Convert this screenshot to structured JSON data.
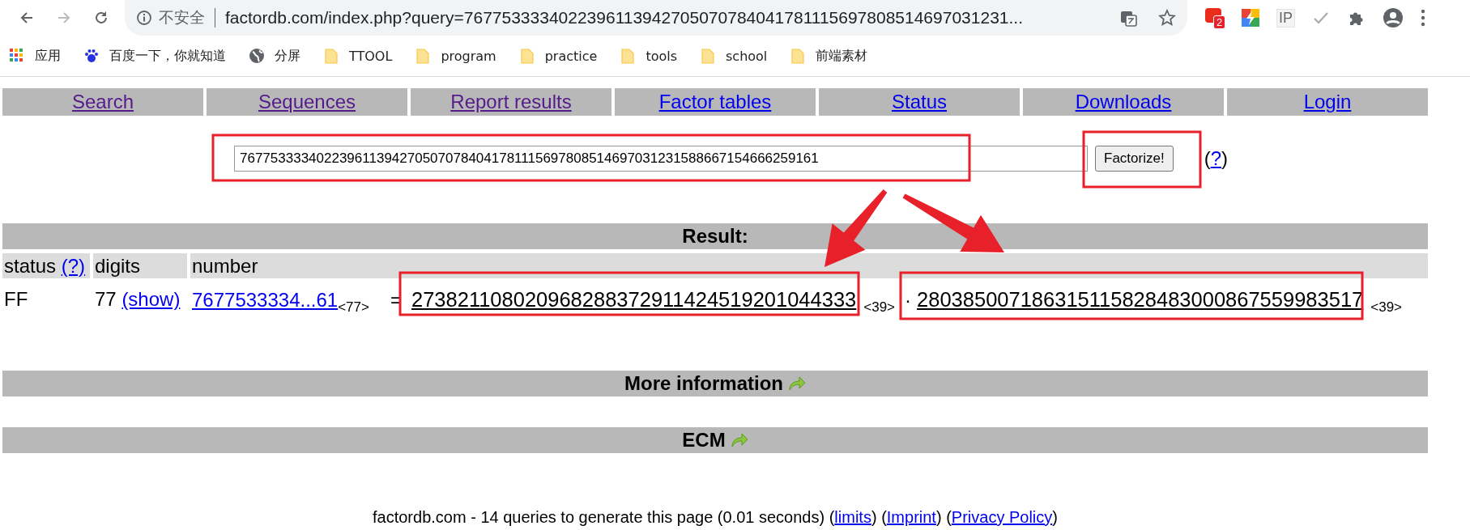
{
  "browser": {
    "nav_buttons": [
      {
        "kind": "back",
        "disabled": false
      },
      {
        "kind": "forward",
        "disabled": true
      },
      {
        "kind": "reload",
        "disabled": false
      }
    ],
    "address": {
      "security_label": "不安全",
      "url": "factordb.com/index.php?query=7677533334022396113942705070784041781115697808514697031231..."
    },
    "address_icons": [
      {
        "kind": "translate"
      },
      {
        "kind": "star"
      }
    ],
    "extensions": [
      {
        "kind": "red",
        "badge": "2"
      },
      {
        "kind": "bolt"
      },
      {
        "kind": "ip",
        "label": "IP"
      },
      {
        "kind": "check"
      },
      {
        "kind": "puzzle"
      },
      {
        "kind": "account"
      },
      {
        "kind": "menu"
      }
    ],
    "bookmarks": [
      {
        "kind": "apps",
        "label": "应用"
      },
      {
        "kind": "paw",
        "label": "百度一下，你就知道"
      },
      {
        "kind": "globe",
        "label": "分屏"
      },
      {
        "kind": "folder",
        "label": "TTOOL"
      },
      {
        "kind": "folder",
        "label": "program"
      },
      {
        "kind": "folder",
        "label": "practice"
      },
      {
        "kind": "folder",
        "label": "tools"
      },
      {
        "kind": "folder",
        "label": "school"
      },
      {
        "kind": "folder",
        "label": "前端素材"
      }
    ]
  },
  "nav": [
    {
      "label": "Search",
      "visited": true
    },
    {
      "label": "Sequences",
      "visited": true
    },
    {
      "label": "Report results",
      "visited": true
    },
    {
      "label": "Factor tables",
      "visited": false
    },
    {
      "label": "Status",
      "visited": false
    },
    {
      "label": "Downloads",
      "visited": false
    },
    {
      "label": "Login",
      "visited": false
    }
  ],
  "query": {
    "value": "7677533334022396113942705070784041781115697808514697031231588667154666259161",
    "button": "Factorize!",
    "help": {
      "open": "(",
      "link": "?",
      "close": ")"
    }
  },
  "result": {
    "title": "Result:",
    "columns": [
      {
        "label": "status",
        "help": "(?)"
      },
      {
        "label": "digits"
      },
      {
        "label": "number"
      }
    ],
    "row": {
      "status": "FF",
      "digits": "77",
      "show": "(show)",
      "number": "7677533334...61",
      "number_digits": "<77>",
      "equals": "=",
      "factors": [
        {
          "value": "273821108020968288372911424519201044333",
          "digits": "<39>"
        },
        {
          "separator": "·",
          "value": "280385007186315115828483000867559983517",
          "digits": "<39>"
        }
      ]
    }
  },
  "sections": [
    {
      "title": "More information"
    },
    {
      "title": "ECM"
    }
  ],
  "footer": {
    "text": "factordb.com - 14 queries to generate this page (0.01 seconds)",
    "links": [
      {
        "open": "(",
        "label": "limits",
        "close": ")"
      },
      {
        "open": "(",
        "label": "Imprint",
        "close": ")"
      },
      {
        "open": "(",
        "label": "Privacy Policy",
        "close": ")"
      }
    ]
  }
}
